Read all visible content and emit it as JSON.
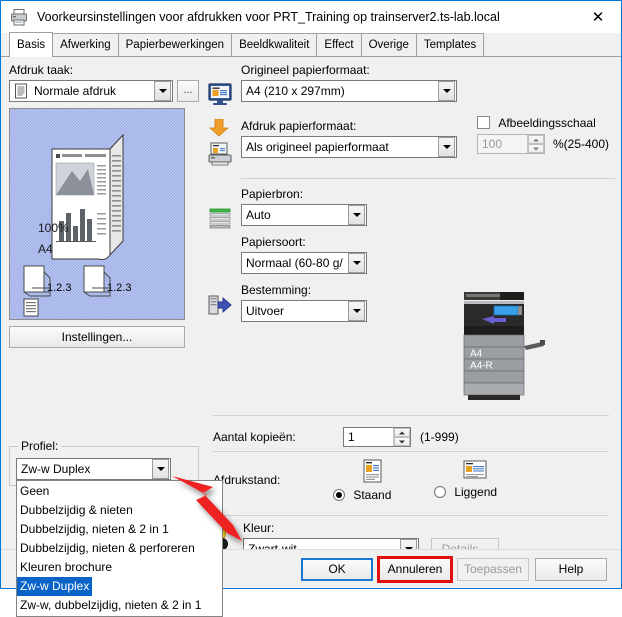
{
  "window": {
    "title": "Voorkeursinstellingen voor afdrukken voor PRT_Training op trainserver2.ts-lab.local",
    "icon": "printer-icon",
    "close_label": "✕"
  },
  "tabs": [
    {
      "label": "Basis",
      "active": true
    },
    {
      "label": "Afwerking",
      "active": false
    },
    {
      "label": "Papierbewerkingen",
      "active": false
    },
    {
      "label": "Beeldkwaliteit",
      "active": false
    },
    {
      "label": "Effect",
      "active": false
    },
    {
      "label": "Overige",
      "active": false
    },
    {
      "label": "Templates",
      "active": false
    }
  ],
  "left": {
    "print_job_label": "Afdruk taak:",
    "print_job_value": "Normale afdruk",
    "more_button_label": "...",
    "preview": {
      "zoom": "100%",
      "paper": "A4",
      "page_order_left": "1.2.3",
      "page_order_right": "1.2.3"
    },
    "settings_button": "Instellingen...",
    "profile_legend": "Profiel:",
    "profile_value": "Zw-w Duplex",
    "profile_options": [
      "Geen",
      "Dubbelzijdig & nieten",
      "Dubbelzijdig, nieten & 2 in 1",
      "Dubbelzijdig, nieten & perforeren",
      "Kleuren brochure",
      "Zw-w Duplex",
      "Zw-w, dubbelzijdig, nieten & 2 in 1"
    ],
    "profile_selected_index": 5
  },
  "right": {
    "original_paper_label": "Origineel papierformaat:",
    "original_paper_value": "A4 (210 x 297mm)",
    "print_paper_label": "Afdruk papierformaat:",
    "print_paper_value": "Als origineel papierformaat",
    "image_scale_label": "Afbeeldingsschaal",
    "image_scale_checked": false,
    "image_scale_value": "100",
    "image_scale_unit": "%(25-400)",
    "paper_source_label": "Papierbron:",
    "paper_source_value": "Auto",
    "paper_type_label": "Papiersoort:",
    "paper_type_value": "Normaal (60-80 g/",
    "destination_label": "Bestemming:",
    "destination_value": "Uitvoer",
    "printer_tray_upper": "A4",
    "printer_tray_lower": "A4-R",
    "copies_label": "Aantal kopieën:",
    "copies_value": "1",
    "copies_range": "(1-999)",
    "orientation_label": "Afdrukstand:",
    "orientation_portrait": "Staand",
    "orientation_landscape": "Liggend",
    "orientation_selected": "Staand",
    "color_label": "Kleur:",
    "color_value": "Zwart-wit",
    "color_details_button": "Details..."
  },
  "footer": {
    "ok": "OK",
    "cancel": "Annuleren",
    "apply": "Toepassen",
    "help": "Help",
    "apply_disabled": true,
    "cancel_highlight_color": "#e10f0f",
    "ok_focus_color": "#1b78d0"
  }
}
